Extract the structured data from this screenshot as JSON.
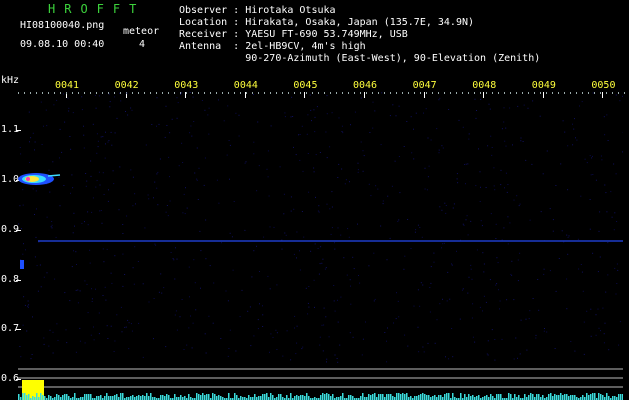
{
  "header": {
    "app_title": "HROFFT",
    "filename": "HI08100040.png",
    "datetime": "09.08.10 00:40",
    "meteor_label": "meteor",
    "meteor_count": "4"
  },
  "info": {
    "observer": "Observer : Hirotaka Otsuka",
    "location": "Location : Hirakata, Osaka, Japan (135.7E, 34.9N)",
    "receiver": "Receiver : YAESU FT-690 53.749MHz, USB",
    "antenna": "Antenna  : 2el-HB9CV, 4m's high",
    "antenna2": "           90-270-Azimuth (East-West), 90-Elevation (Zenith)"
  },
  "axes": {
    "y_unit": "kHz",
    "y_labels": [
      "1.1",
      "1.0",
      "0.9",
      "0.8",
      "0.7",
      "0.6"
    ],
    "x_labels": [
      "0041",
      "0042",
      "0043",
      "0044",
      "0045",
      "0046",
      "0047",
      "0048",
      "0049",
      "0050"
    ]
  },
  "colors": {
    "background": "#000000",
    "title_green": "#3cd23c",
    "tick_yellow": "#ffff3c",
    "carrier_blue": "#1e3cc8"
  }
}
